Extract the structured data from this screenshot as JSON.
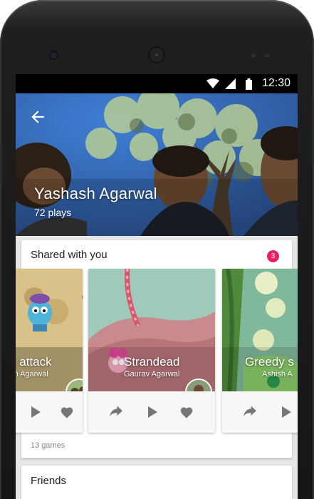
{
  "status_bar": {
    "time": "12:30"
  },
  "profile": {
    "name": "Yashash Agarwal",
    "plays": "72 plays"
  },
  "shared": {
    "title": "Shared with you",
    "badge": "3",
    "games": [
      {
        "name": "s attack",
        "author": "sh Agarwal"
      },
      {
        "name": "Strandead",
        "author": "Gaurav Agarwal"
      },
      {
        "name": "Greedy s",
        "author": "Ashish A"
      }
    ],
    "count": "13 games"
  },
  "friends": {
    "title": "Friends"
  },
  "icons": {
    "back": "arrow-left-icon",
    "share": "share-icon",
    "play": "play-icon",
    "like": "heart-icon",
    "wifi": "wifi-icon",
    "signal": "signal-icon",
    "battery": "battery-icon"
  },
  "colors": {
    "accent": "#e91e63"
  }
}
